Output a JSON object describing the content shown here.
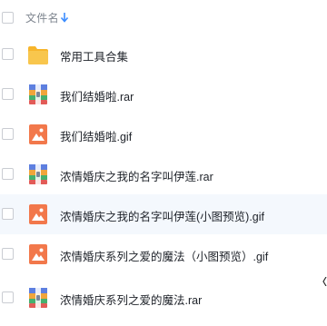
{
  "header": {
    "column_label": "文件名",
    "sort_icon": "arrow-down-icon",
    "accent_color": "#3b8cff"
  },
  "colors": {
    "folder": "#f8c64d",
    "image_file": "#f2784b",
    "archive_file": "#5d7fe0",
    "row_highlight": "#f4f8fd"
  },
  "files": [
    {
      "name": "常用工具合集",
      "icon": "folder-icon"
    },
    {
      "name": "我们结婚啦.rar",
      "icon": "archive-icon"
    },
    {
      "name": "我们结婚啦.gif",
      "icon": "image-icon"
    },
    {
      "name": "浓情婚庆之我的名字叫伊莲.rar",
      "icon": "archive-icon"
    },
    {
      "name": "浓情婚庆之我的名字叫伊莲(小图预览).gif",
      "icon": "image-icon"
    },
    {
      "name": "浓情婚庆系列之爱的魔法（小图预览）.gif",
      "icon": "image-icon"
    },
    {
      "name": "浓情婚庆系列之爱的魔法.rar",
      "icon": "archive-icon"
    }
  ]
}
